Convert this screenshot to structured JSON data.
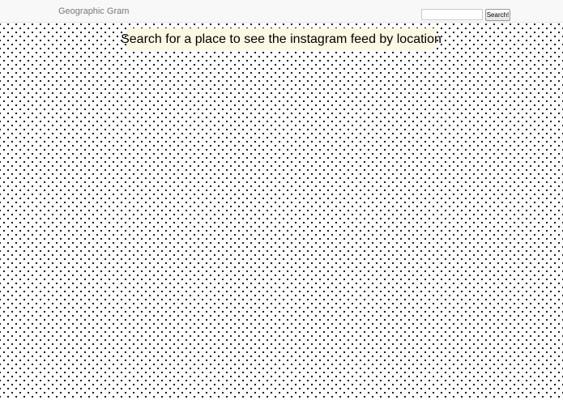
{
  "navbar": {
    "brand": "Geographic Gram",
    "search": {
      "placeholder": "",
      "value": "",
      "button_label": "Search!"
    }
  },
  "main": {
    "banner_text": "Search for a place to see the instagram feed by location"
  },
  "colors": {
    "navbar_bg": "#f8f8f8",
    "banner_bg": "#fcf8e3",
    "background_dot": "#222222",
    "background": "#ffffff"
  }
}
